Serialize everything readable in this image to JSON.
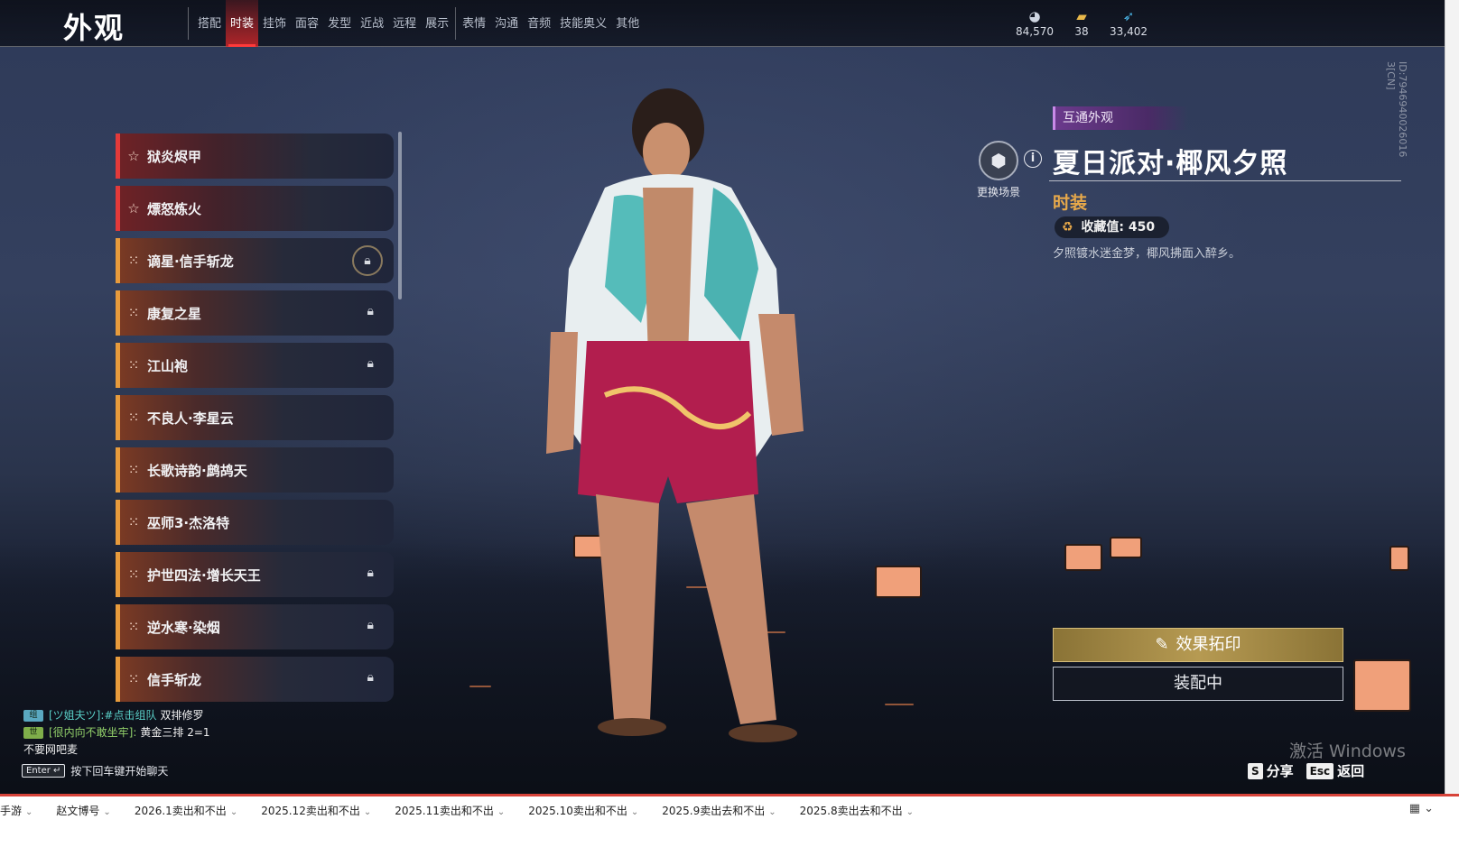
{
  "header": {
    "title": "外观",
    "tabs_group1": [
      "搭配",
      "时装",
      "挂饰",
      "面容",
      "发型",
      "近战",
      "远程",
      "展示"
    ],
    "tabs_group2": [
      "表情",
      "沟通",
      "音频",
      "技能奥义",
      "其他"
    ],
    "active_tab": "时装"
  },
  "currencies": [
    {
      "icon": "coin-icon",
      "value": "84,570"
    },
    {
      "icon": "ticket-icon",
      "value": "38"
    },
    {
      "icon": "feather-icon",
      "value": "33,402"
    }
  ],
  "list": {
    "items": [
      {
        "name": "狱炎烬甲",
        "mark": "star",
        "locked": false
      },
      {
        "name": "熛怒炼火",
        "mark": "star",
        "locked": false
      },
      {
        "name": "谪星·信手斩龙",
        "mark": "cross",
        "locked": true
      },
      {
        "name": "康复之星",
        "mark": "cross",
        "locked": true
      },
      {
        "name": "江山袍",
        "mark": "cross",
        "locked": true
      },
      {
        "name": "不良人·李星云",
        "mark": "cross",
        "locked": false
      },
      {
        "name": "长歌诗韵·鹧鸪天",
        "mark": "cross",
        "locked": false
      },
      {
        "name": "巫师3·杰洛特",
        "mark": "cross",
        "locked": false
      },
      {
        "name": "护世四法·增长天王",
        "mark": "cross",
        "locked": true
      },
      {
        "name": "逆水寒·染烟",
        "mark": "cross",
        "locked": true
      },
      {
        "name": "信手斩龙",
        "mark": "cross",
        "locked": true
      }
    ]
  },
  "detail": {
    "tag": "互通外观",
    "scene_label": "更换场景",
    "title": "夏日派对·椰风夕照",
    "category": "时装",
    "collect_label": "收藏值:",
    "collect_value": "450",
    "description": "夕照镀水迷金梦，椰风拂面入醉乡。",
    "id_text": "ID:7946940026016 3[CN]",
    "effect_button": "效果拓印",
    "equip_button": "装配中"
  },
  "chat": {
    "lines": [
      {
        "badge": "blue",
        "speaker": "[ツ姐夫ツ]:#点击组队",
        "message": "双排修罗"
      },
      {
        "badge": "green",
        "speaker": "[很内向不敢坐牢]:",
        "message": "黄金三排 2=1"
      },
      {
        "badge": "",
        "speaker": "",
        "message": "不要网吧麦"
      }
    ],
    "input_key": "Enter ↵",
    "input_hint": "按下回车键开始聊天"
  },
  "bottom_right": {
    "watermark": "激活 Windows",
    "share_key": "S",
    "share_label": "分享",
    "back_key": "Esc",
    "back_label": "返回"
  },
  "bookmarks": [
    "手游",
    "赵文博号",
    "2026.1卖出和不出",
    "2025.12卖出和不出",
    "2025.11卖出和不出",
    "2025.10卖出和不出",
    "2025.9卖出去和不出",
    "2025.8卖出去和不出"
  ],
  "colors": {
    "accent_red": "#ff3a3a",
    "gold": "#e8a94a",
    "purple_tag": "#6b3a8c"
  }
}
